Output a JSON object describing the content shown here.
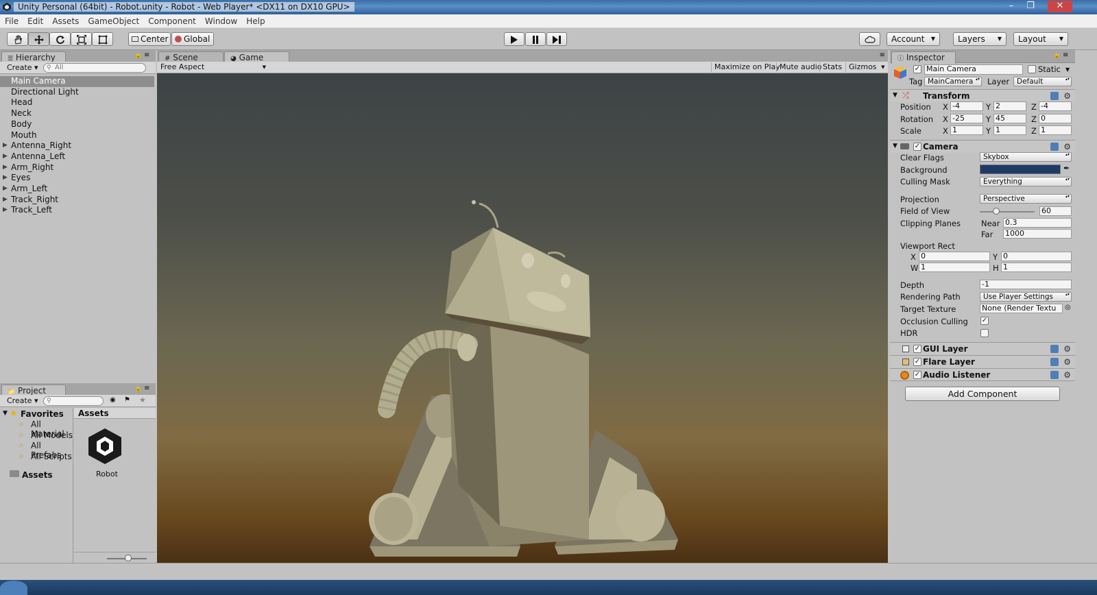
{
  "window": {
    "title": "Unity Personal (64bit) - Robot.unity - Robot - Web Player* <DX11 on DX10 GPU>"
  },
  "menu": [
    "File",
    "Edit",
    "Assets",
    "GameObject",
    "Component",
    "Window",
    "Help"
  ],
  "toolbar": {
    "pivot": "Center",
    "space": "Global",
    "account": "Account",
    "layers": "Layers",
    "layout": "Layout"
  },
  "hierarchy": {
    "tab": "Hierarchy",
    "create": "Create",
    "search_placeholder": "All",
    "items": [
      {
        "label": "Main Camera",
        "selected": true,
        "expandable": false
      },
      {
        "label": "Directional Light",
        "expandable": false
      },
      {
        "label": "Head",
        "expandable": false
      },
      {
        "label": "Neck",
        "expandable": false
      },
      {
        "label": "Body",
        "expandable": false
      },
      {
        "label": "Mouth",
        "expandable": false
      },
      {
        "label": "Antenna_Right",
        "expandable": true
      },
      {
        "label": "Antenna_Left",
        "expandable": true
      },
      {
        "label": "Arm_Right",
        "expandable": true
      },
      {
        "label": "Eyes",
        "expandable": true
      },
      {
        "label": "Arm_Left",
        "expandable": true
      },
      {
        "label": "Track_Right",
        "expandable": true
      },
      {
        "label": "Track_Left",
        "expandable": true
      }
    ]
  },
  "project": {
    "tab": "Project",
    "create": "Create",
    "favorites_label": "Favorites",
    "favorites": [
      "All Material",
      "All Models",
      "All Prefabs",
      "All Scripts"
    ],
    "assets_folder": "Assets",
    "assets_header": "Assets",
    "asset_item": "Robot"
  },
  "views": {
    "scene_tab": "Scene",
    "game_tab": "Game",
    "aspect": "Free Aspect",
    "maximize": "Maximize on Play",
    "mute": "Mute audio",
    "stats": "Stats",
    "gizmos": "Gizmos"
  },
  "inspector": {
    "tab": "Inspector",
    "object_name": "Main Camera",
    "static_label": "Static",
    "tag_label": "Tag",
    "tag_value": "MainCamera",
    "layer_label": "Layer",
    "layer_value": "Default",
    "transform": {
      "title": "Transform",
      "position_label": "Position",
      "rotation_label": "Rotation",
      "scale_label": "Scale",
      "position": [
        "-4",
        "2",
        "-4"
      ],
      "rotation": [
        "-25",
        "45",
        "0"
      ],
      "scale": [
        "1",
        "1",
        "1"
      ]
    },
    "camera": {
      "title": "Camera",
      "clear_flags_label": "Clear Flags",
      "clear_flags": "Skybox",
      "background_label": "Background",
      "background_color": "#1f3a66",
      "culling_mask_label": "Culling Mask",
      "culling_mask": "Everything",
      "projection_label": "Projection",
      "projection": "Perspective",
      "fov_label": "Field of View",
      "fov": "60",
      "fov_fraction": 0.3,
      "clipping_label": "Clipping Planes",
      "near_label": "Near",
      "near": "0.3",
      "far_label": "Far",
      "far": "1000",
      "viewport_label": "Viewport Rect",
      "vx": "0",
      "vy": "0",
      "vw": "1",
      "vh": "1",
      "depth_label": "Depth",
      "depth": "-1",
      "rendering_label": "Rendering Path",
      "rendering": "Use Player Settings",
      "target_label": "Target Texture",
      "target": "None (Render Textu",
      "occlusion_label": "Occlusion Culling",
      "hdr_label": "HDR"
    },
    "gui_layer": "GUI Layer",
    "flare_layer": "Flare Layer",
    "audio_listener": "Audio Listener",
    "add_component": "Add Component"
  }
}
